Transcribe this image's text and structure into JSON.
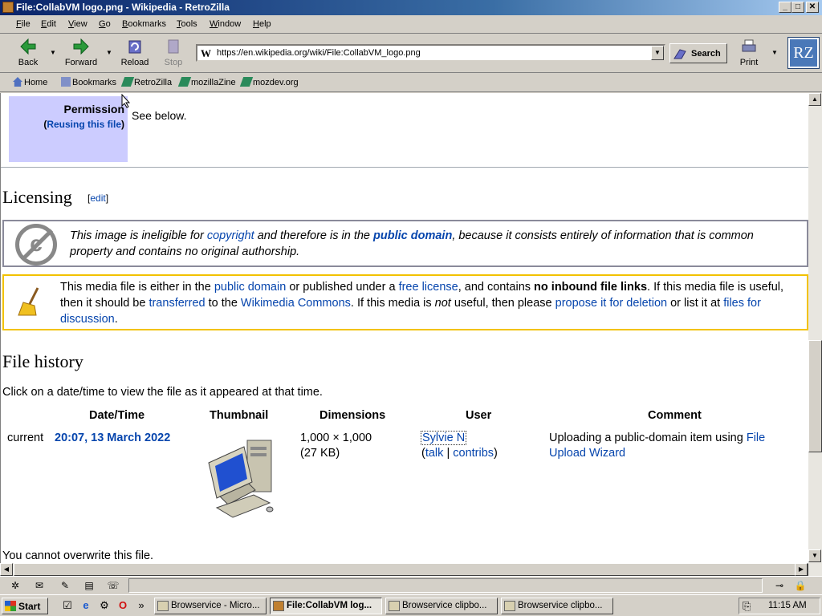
{
  "window": {
    "title": "File:CollabVM logo.png - Wikipedia - RetroZilla",
    "controls": [
      "_",
      "□",
      "✕"
    ]
  },
  "menu": [
    "File",
    "Edit",
    "View",
    "Go",
    "Bookmarks",
    "Tools",
    "Window",
    "Help"
  ],
  "toolbar": {
    "back": "Back",
    "forward": "Forward",
    "reload": "Reload",
    "stop": "Stop",
    "url": "https://en.wikipedia.org/wiki/File:CollabVM_logo.png",
    "search": "Search",
    "print": "Print",
    "logo": "RZ"
  },
  "bookmarks": [
    "Home",
    "Bookmarks",
    "RetroZilla",
    "mozillaZine",
    "mozdev.org"
  ],
  "page": {
    "permission_label": "Permission",
    "permission_reuse": "Reusing this file",
    "permission_value": "See below.",
    "licensing_heading": "Licensing",
    "licensing_edit": "edit",
    "pd_notice": {
      "t1": "This image is ineligible for ",
      "link1": "copyright",
      "t2": " and therefore is in the ",
      "link2": "public domain",
      "t3": ", because it consists entirely of information that is common property and contains no original authorship."
    },
    "wc_notice": {
      "t1": "This media file is either in the ",
      "link1": "public domain",
      "t2": " or published under a ",
      "link2": "free license",
      "t3": ", and contains ",
      "bold1": "no inbound file links",
      "t4": ". If this media file is useful, then it should be ",
      "link3": "transferred",
      "t5": " to the ",
      "link4": "Wikimedia Commons",
      "t6": ". If this media is ",
      "em1": "not",
      "t7": " useful, then please ",
      "link5": "propose it for deletion",
      "t8": " or list it at ",
      "link6": "files for discussion",
      "t9": "."
    },
    "file_history_heading": "File history",
    "file_history_intro": "Click on a date/time to view the file as it appeared at that time.",
    "columns": [
      "Date/Time",
      "Thumbnail",
      "Dimensions",
      "User",
      "Comment"
    ],
    "row": {
      "status": "current",
      "datetime": "20:07, 13 March 2022",
      "dimensions": "1,000 × 1,000",
      "size": "(27 KB)",
      "user": "Sylvie N",
      "talk": "talk",
      "contribs": "contribs",
      "comment_text": "Uploading a public-domain item using ",
      "comment_link1": "File",
      "comment_link2": "Upload Wizard"
    },
    "overwrite_notice": "You cannot overwrite this file."
  },
  "taskbar": {
    "start": "Start",
    "tasks": [
      "Browservice - Micro...",
      "File:CollabVM log...",
      "Browservice clipbo...",
      "Browservice clipbo..."
    ],
    "clock": "11:15 AM"
  }
}
